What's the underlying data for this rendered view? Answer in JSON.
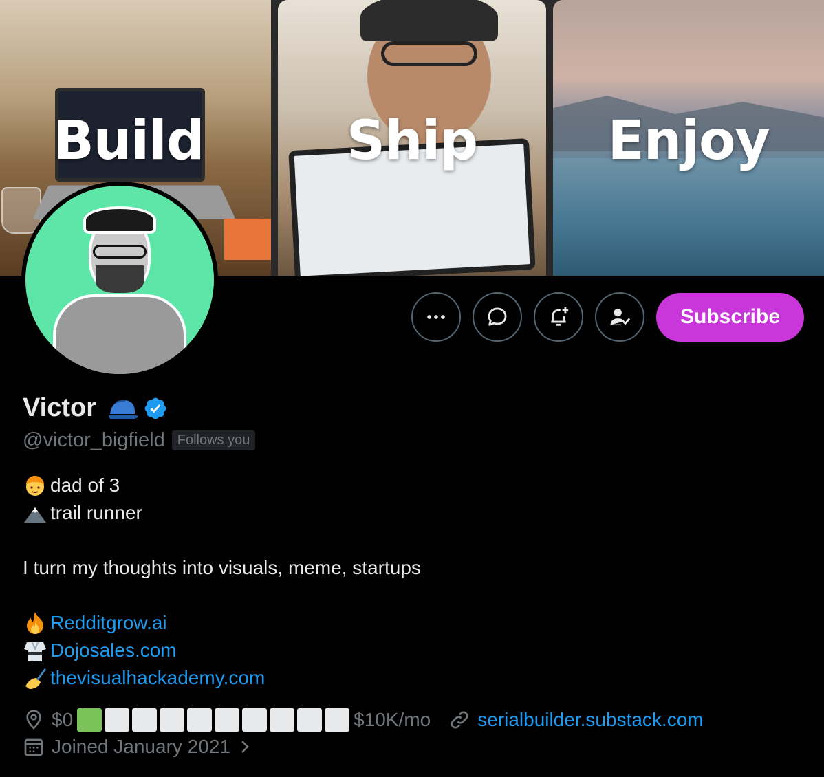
{
  "banner": {
    "panels": [
      {
        "word": "Build"
      },
      {
        "word": "Ship"
      },
      {
        "word": "Enjoy"
      }
    ]
  },
  "actions": {
    "more_icon": "more-icon",
    "message_icon": "message-icon",
    "notify_icon": "bell-plus-icon",
    "following_icon": "person-check-icon",
    "subscribe_label": "Subscribe"
  },
  "profile": {
    "name": "Victor",
    "handle": "@victor_bigfield",
    "follows_badge": "Follows you",
    "verified": true
  },
  "bio": {
    "line1": "dad of 3",
    "line2": "trail runner",
    "line3": "I turn my thoughts into visuals, meme, startups",
    "links": [
      {
        "text": "Redditgrow.ai"
      },
      {
        "text": "Dojosales.com"
      },
      {
        "text": "thevisualhackademy.com"
      }
    ]
  },
  "meta": {
    "location_start": "$0",
    "location_end": "$10K/mo",
    "progress_filled": 1,
    "progress_total": 10,
    "website": "serialbuilder.substack.com",
    "joined": "Joined January 2021"
  },
  "colors": {
    "accent_link": "#1d9bf0",
    "subscribe": "#c936d9",
    "muted": "#71767b",
    "avatar_bg": "#5ee6a8",
    "progress_filled": "#7cc25b"
  }
}
